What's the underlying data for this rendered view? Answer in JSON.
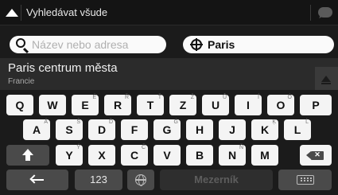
{
  "header": {
    "title": "Vyhledávat všude"
  },
  "search": {
    "placeholder": "Název nebo adresa",
    "value": ""
  },
  "city": {
    "label": "Paris"
  },
  "result": {
    "name": "Paris centrum města",
    "country": "Francie"
  },
  "keyboard": {
    "row1": [
      {
        "label": "Q",
        "alt": ""
      },
      {
        "label": "W",
        "alt": ""
      },
      {
        "label": "E",
        "alt": "É"
      },
      {
        "label": "R",
        "alt": "Ř"
      },
      {
        "label": "T",
        "alt": "Ť"
      },
      {
        "label": "Z",
        "alt": "Ž"
      },
      {
        "label": "U",
        "alt": "Ů"
      },
      {
        "label": "I",
        "alt": "Í"
      },
      {
        "label": "O",
        "alt": "Ó"
      },
      {
        "label": "P",
        "alt": ""
      }
    ],
    "row2": [
      {
        "label": "A",
        "alt": "Á"
      },
      {
        "label": "S",
        "alt": "Š"
      },
      {
        "label": "D",
        "alt": "Ď"
      },
      {
        "label": "F",
        "alt": ""
      },
      {
        "label": "G",
        "alt": "Ġ"
      },
      {
        "label": "H",
        "alt": ""
      },
      {
        "label": "J",
        "alt": ""
      },
      {
        "label": "K",
        "alt": "Ķ"
      },
      {
        "label": "L",
        "alt": "Ĺ"
      }
    ],
    "row3": [
      {
        "label": "Y",
        "alt": "Ý"
      },
      {
        "label": "X",
        "alt": ""
      },
      {
        "label": "C",
        "alt": "Č"
      },
      {
        "label": "V",
        "alt": ""
      },
      {
        "label": "B",
        "alt": ""
      },
      {
        "label": "N",
        "alt": "Ň"
      },
      {
        "label": "M",
        "alt": ""
      }
    ],
    "numbers_label": "123",
    "space_label": "Mezerník"
  },
  "icons": {
    "back": "nav-arrow-icon",
    "chat": "chat-bubble-icon",
    "search": "search-icon",
    "city": "crosshair-icon",
    "scroll": "eject-icon"
  }
}
